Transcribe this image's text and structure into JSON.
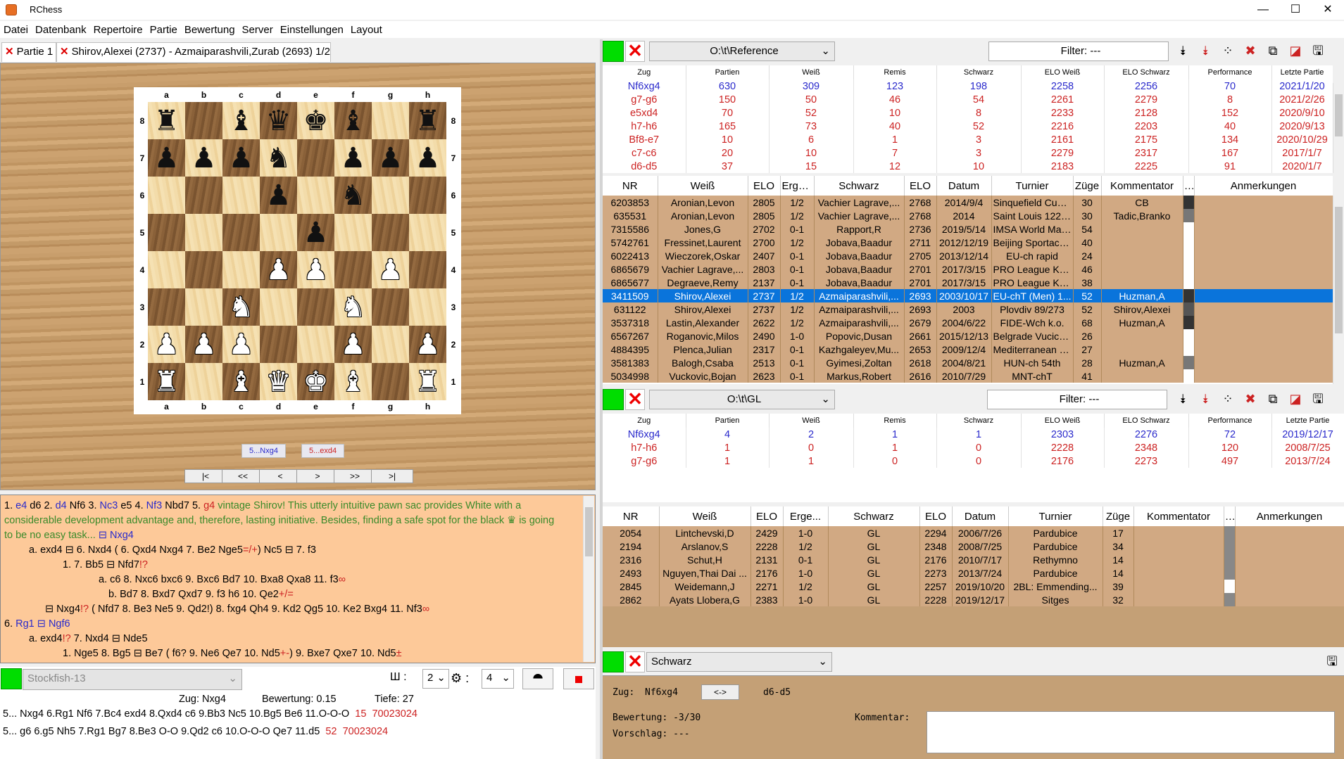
{
  "window": {
    "title": "RChess",
    "minimize": "—",
    "maximize": "☐",
    "close": "✕"
  },
  "menu": [
    "Datei",
    "Datenbank",
    "Repertoire",
    "Partie",
    "Bewertung",
    "Server",
    "Einstellungen",
    "Layout"
  ],
  "tabs": [
    {
      "label": "Partie 1",
      "close": "✕"
    },
    {
      "label": "Shirov,Alexei (2737) - Azmaiparashvili,Zurab (2693) 1/2",
      "close": "✕"
    }
  ],
  "board": {
    "files": [
      "a",
      "b",
      "c",
      "d",
      "e",
      "f",
      "g",
      "h"
    ],
    "ranks": [
      "8",
      "7",
      "6",
      "5",
      "4",
      "3",
      "2",
      "1"
    ],
    "position": [
      [
        "bR",
        "",
        "bB",
        "bQ",
        "bK",
        "bB",
        "",
        "bR"
      ],
      [
        "bP",
        "bP",
        "bP",
        "bN",
        "",
        "bP",
        "bP",
        "bP"
      ],
      [
        "",
        "",
        "",
        "bP",
        "",
        "bN",
        "",
        ""
      ],
      [
        "",
        "",
        "",
        "",
        "bP",
        "",
        "",
        ""
      ],
      [
        "",
        "",
        "",
        "wP",
        "wP",
        "",
        "wP",
        ""
      ],
      [
        "",
        "",
        "wN",
        "",
        "",
        "wN",
        "",
        ""
      ],
      [
        "wP",
        "wP",
        "wP",
        "",
        "",
        "wP",
        "",
        "wP"
      ],
      [
        "wR",
        "",
        "wB",
        "wQ",
        "wK",
        "wB",
        "",
        "wR"
      ]
    ],
    "next_moves": [
      "5...Nxg4",
      "5...exd4"
    ],
    "nav": [
      "|<",
      "<<",
      "<",
      ">",
      ">>",
      ">|"
    ]
  },
  "notation": {
    "l1": [
      "1.",
      "e4",
      "d6",
      "2.",
      "d4",
      "Nf6",
      "3.",
      "Nc3",
      "e5",
      "4.",
      "Nf3",
      "Nbd7",
      "5.",
      "g4",
      "vintage Shirov! This utterly intuitive pawn sac provides White with a"
    ],
    "l2": "considerable development advantage and, therefore, lasting initiative. Besides, finding a safe spot for the black ♛ is going",
    "l3a": "to be no easy task...",
    "l3b": "⊟ Nxg4",
    "l4a": "a. exd4 ⊟ 6. Nxd4 ( 6. Qxd4 Nxg4 7. Be2 Nge5",
    "l4b": "=/+",
    "l4c": ") Nc5 ⊟ 7. f3",
    "l5a": "1. 7. Bb5 ⊟ Nfd7",
    "l5b": "!?",
    "l6a": "a. c6 8. Nxc6 bxc6 9. Bxc6 Bd7 10. Bxa8 Qxa8 11. f3",
    "l6b": "∞",
    "l7a": "b. Bd7 8. Bxd7 Qxd7 9. f3 h6 10. Qe2",
    "l7b": "+/=",
    "l8a": "⊟ Nxg4",
    "l8b": "!?",
    "l8c": "( Nfd7 8. Be3 Ne5 9. Qd2!) 8. fxg4 Qh4 9. Kd2 Qg5 10. Ke2 Bxg4 11. Nf3",
    "l8d": "∞",
    "l9a": "6.",
    "l9b": "Rg1",
    "l9c": "⊟ Ngf6",
    "l10a": "a. exd4",
    "l10b": "!?",
    "l10c": "7. Nxd4 ⊟ Nde5",
    "l11a": "1. Nge5 8. Bg5 ⊟ Be7 ( f6? 9. Ne6 Qe7 10. Nd5",
    "l11b": "+-",
    "l11c": ") 9. Bxe7 Qxe7 10. Nd5",
    "l11d": "±"
  },
  "engine": {
    "name": "Stockfish-13",
    "threads": "2",
    "hash": "4",
    "status_move": "Zug: Nxg4",
    "status_eval": "Bewertung: 0.15",
    "status_depth": "Tiefe: 27",
    "lines": [
      {
        "text": "5... Nxg4 6.Rg1 Nf6 7.Bc4 exd4 8.Qxd4 c6 9.Bb3 Nc5 10.Bg5 Be6 11.O-O-O",
        "score": "15",
        "nodes": "70023024"
      },
      {
        "text": "5... g6 6.g5 Nh5 7.Rg1 Bg7 8.Be3 O-O 9.Qd2 c6 10.O-O-O Qe7 11.d5",
        "score": "52",
        "nodes": "70023024"
      }
    ]
  },
  "ref_db": {
    "path": "O:\\t\\Reference",
    "filter": "Filter: ---",
    "stat_headers": [
      "Zug",
      "Partien",
      "Weiß",
      "Remis",
      "Schwarz",
      "ELO Weiß",
      "ELO Schwarz",
      "Performance",
      "Letzte Partie"
    ],
    "stats": [
      [
        "Nf6xg4",
        "630",
        "309",
        "123",
        "198",
        "2258",
        "2256",
        "70",
        "2021/1/20"
      ],
      [
        "g7-g6",
        "150",
        "50",
        "46",
        "54",
        "2261",
        "2279",
        "8",
        "2021/2/26"
      ],
      [
        "e5xd4",
        "70",
        "52",
        "10",
        "8",
        "2233",
        "2128",
        "152",
        "2020/9/10"
      ],
      [
        "h7-h6",
        "165",
        "73",
        "40",
        "52",
        "2216",
        "2203",
        "40",
        "2020/9/13"
      ],
      [
        "Bf8-e7",
        "10",
        "6",
        "1",
        "3",
        "2161",
        "2175",
        "134",
        "2020/10/29"
      ],
      [
        "c7-c6",
        "20",
        "10",
        "7",
        "3",
        "2279",
        "2317",
        "167",
        "2017/1/7"
      ],
      [
        "d6-d5",
        "37",
        "15",
        "12",
        "10",
        "2183",
        "2225",
        "91",
        "2020/1/7"
      ]
    ],
    "game_headers": [
      "NR",
      "Weiß",
      "ELO",
      "Erge...",
      "Schwarz",
      "ELO",
      "Datum",
      "Turnier",
      "Züge",
      "Kommentator",
      "...",
      "Anmerkungen"
    ],
    "games": [
      [
        "6203853",
        "Aronian,Levon",
        "2805",
        "1/2",
        "Vachier Lagrave,...",
        "2768",
        "2014/9/4",
        "Sinquefield Cup 2...",
        "30",
        "CB"
      ],
      [
        "635531",
        "Aronian,Levon",
        "2805",
        "1/2",
        "Vachier Lagrave,...",
        "2768",
        "2014",
        "Saint Louis 122/...",
        "30",
        "Tadic,Branko"
      ],
      [
        "7315586",
        "Jones,G",
        "2702",
        "0-1",
        "Rapport,R",
        "2736",
        "2019/5/14",
        "IMSA World Mas...",
        "54",
        ""
      ],
      [
        "5742761",
        "Fressinet,Laurent",
        "2700",
        "1/2",
        "Jobava,Baadur",
        "2711",
        "2012/12/19",
        "Beijing Sportacco...",
        "40",
        ""
      ],
      [
        "6022413",
        "Wieczorek,Oskar",
        "2407",
        "0-1",
        "Jobava,Baadur",
        "2705",
        "2013/12/14",
        "EU-ch rapid",
        "24",
        ""
      ],
      [
        "6865679",
        "Vachier Lagrave,...",
        "2803",
        "0-1",
        "Jobava,Baadur",
        "2701",
        "2017/3/15",
        "PRO League KO ...",
        "46",
        ""
      ],
      [
        "6865677",
        "Degraeve,Remy",
        "2137",
        "0-1",
        "Jobava,Baadur",
        "2701",
        "2017/3/15",
        "PRO League KO ...",
        "38",
        ""
      ],
      [
        "3411509",
        "Shirov,Alexei",
        "2737",
        "1/2",
        "Azmaiparashvili,...",
        "2693",
        "2003/10/17",
        "EU-chT (Men) 1...",
        "52",
        "Huzman,A"
      ],
      [
        "631122",
        "Shirov,Alexei",
        "2737",
        "1/2",
        "Azmaiparashvili,...",
        "2693",
        "2003",
        "Plovdiv 89/273",
        "52",
        "Shirov,Alexei"
      ],
      [
        "3537318",
        "Lastin,Alexander",
        "2622",
        "1/2",
        "Azmaiparashvili,...",
        "2679",
        "2004/6/22",
        "FIDE-Wch k.o.",
        "68",
        "Huzman,A"
      ],
      [
        "6567267",
        "Roganovic,Milos",
        "2490",
        "1-0",
        "Popovic,Dusan",
        "2661",
        "2015/12/13",
        "Belgrade Vucicev...",
        "26",
        ""
      ],
      [
        "4884395",
        "Plenca,Julian",
        "2317",
        "0-1",
        "Kazhgaleyev,Mu...",
        "2653",
        "2009/12/4",
        "Mediterranean o...",
        "27",
        ""
      ],
      [
        "3581383",
        "Balogh,Csaba",
        "2513",
        "0-1",
        "Gyimesi,Zoltan",
        "2618",
        "2004/8/21",
        "HUN-ch 54th",
        "28",
        "Huzman,A"
      ],
      [
        "5034998",
        "Vuckovic,Bojan",
        "2623",
        "0-1",
        "Markus,Robert",
        "2616",
        "2010/7/29",
        "MNT-chT",
        "41",
        ""
      ]
    ]
  },
  "gl_db": {
    "path": "O:\\t\\GL",
    "filter": "Filter: ---",
    "stats": [
      [
        "Nf6xg4",
        "4",
        "2",
        "1",
        "1",
        "2303",
        "2276",
        "72",
        "2019/12/17"
      ],
      [
        "h7-h6",
        "1",
        "0",
        "1",
        "0",
        "2228",
        "2348",
        "120",
        "2008/7/25"
      ],
      [
        "g7-g6",
        "1",
        "1",
        "0",
        "0",
        "2176",
        "2273",
        "497",
        "2013/7/24"
      ]
    ],
    "games": [
      [
        "2054",
        "Lintchevski,D",
        "2429",
        "1-0",
        "GL",
        "2294",
        "2006/7/26",
        "Pardubice",
        "17"
      ],
      [
        "2194",
        "Arslanov,S",
        "2228",
        "1/2",
        "GL",
        "2348",
        "2008/7/25",
        "Pardubice",
        "34"
      ],
      [
        "2316",
        "Schut,H",
        "2131",
        "0-1",
        "GL",
        "2176",
        "2010/7/17",
        "Rethymno",
        "14"
      ],
      [
        "2493",
        "Nguyen,Thai Dai ...",
        "2176",
        "1-0",
        "GL",
        "2273",
        "2013/7/24",
        "Pardubice",
        "14"
      ],
      [
        "2845",
        "Weidemann,J",
        "2271",
        "1/2",
        "GL",
        "2257",
        "2019/10/20",
        "2BL: Emmending...",
        "39"
      ],
      [
        "2862",
        "Ayats Llobera,G",
        "2383",
        "1-0",
        "GL",
        "2228",
        "2019/12/17",
        "Sitges",
        "32"
      ]
    ]
  },
  "repertoire": {
    "side": "Schwarz",
    "zug_label": "Zug:",
    "zug_value": "Nf6xg4",
    "swap": "<->",
    "alt_move": "d6-d5",
    "bewertung": "Bewertung: -3/30",
    "vorschlag": "Vorschlag: ---",
    "kommentar": "Kommentar:"
  }
}
